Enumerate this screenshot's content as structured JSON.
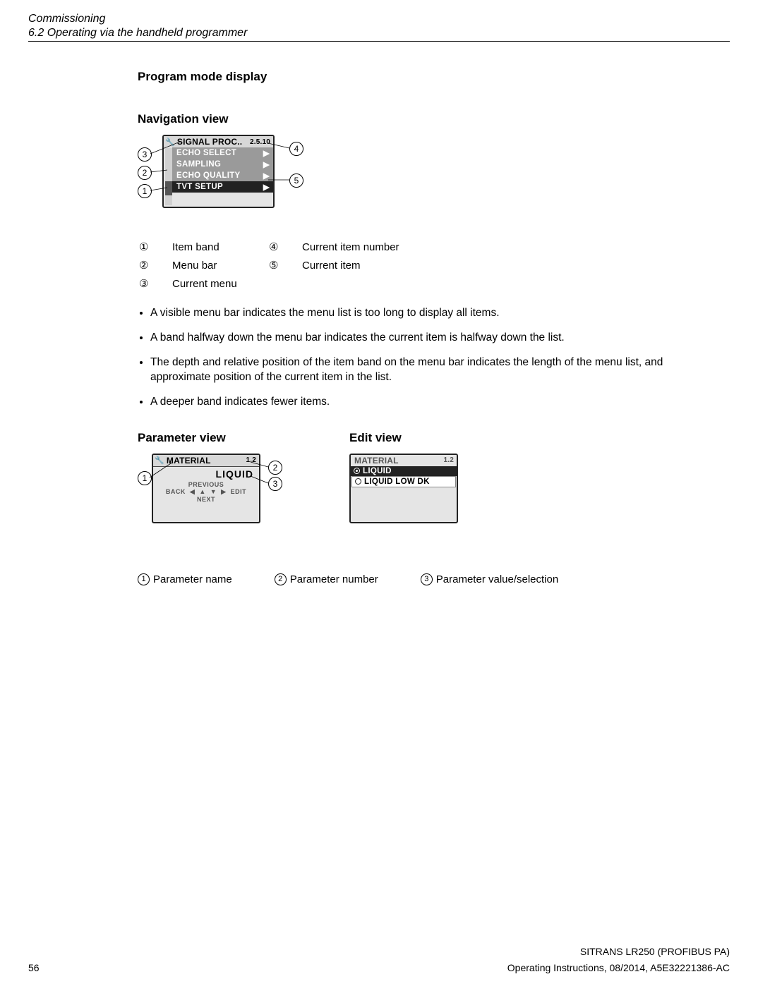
{
  "header": {
    "chapter": "Commissioning",
    "section": "6.2 Operating via the handheld programmer"
  },
  "h1": "Program mode display",
  "nav": {
    "heading": "Navigation view",
    "lcd": {
      "title": "SIGNAL PROC..",
      "title_num": "2.5.10",
      "items": [
        "ECHO SELECT",
        "SAMPLING",
        "ECHO QUALITY",
        "TVT SETUP"
      ]
    },
    "legend": {
      "n1": "①",
      "l1": "Item band",
      "n2": "②",
      "l2": "Menu bar",
      "n3": "③",
      "l3": "Current menu",
      "n4": "④",
      "l4": "Current item number",
      "n5": "⑤",
      "l5": "Current item"
    },
    "bullets": [
      "A visible menu bar indicates the menu list is too long to display all items.",
      "A band halfway down the menu bar indicates the current item is halfway down the list.",
      "The depth and relative position of the item band on the menu bar indicates the length of the menu list, and approximate position of the current item in the list.",
      "A deeper band indicates fewer items."
    ]
  },
  "param": {
    "heading": "Parameter view",
    "lcd": {
      "title": "MATERIAL",
      "title_num": "1.2",
      "value": "LIQUID",
      "prev": "PREVIOUS",
      "back": "BACK",
      "edit": "EDIT",
      "next": "NEXT"
    }
  },
  "edit": {
    "heading": "Edit view",
    "lcd": {
      "title": "MATERIAL",
      "title_num": "1.2",
      "opt1": "LIQUID",
      "opt2": "LIQUID LOW DK"
    }
  },
  "legend2": {
    "n1": "①",
    "l1": "Parameter name",
    "n2": "②",
    "l2": "Parameter number",
    "n3": "③",
    "l3": "Parameter value/selection"
  },
  "footer": {
    "product": "SITRANS LR250 (PROFIBUS PA)",
    "page": "56",
    "docinfo": "Operating Instructions, 08/2014, A5E32221386-AC"
  },
  "callouts": {
    "c1": "1",
    "c2": "2",
    "c3": "3",
    "c4": "4",
    "c5": "5"
  }
}
